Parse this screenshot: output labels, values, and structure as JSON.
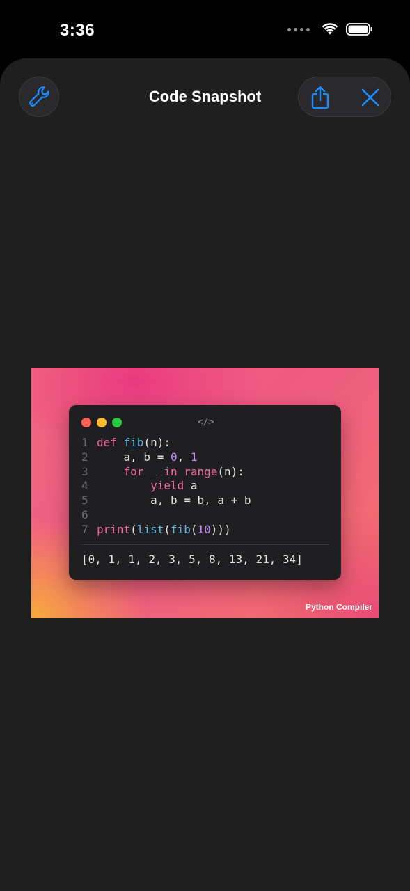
{
  "status_bar": {
    "time": "3:36"
  },
  "header": {
    "title": "Code Snapshot",
    "left_button_icon": "wrench-icon",
    "share_button_icon": "share-icon",
    "close_button_icon": "close-icon"
  },
  "colors": {
    "accent": "#1a8cff",
    "sheet_background": "#1f1f20",
    "code_background": "#1f1f21"
  },
  "snapshot": {
    "window_icon": "code-brackets-icon",
    "window_icon_glyph": "</>",
    "code_lines": [
      {
        "number": "1",
        "tokens": [
          {
            "t": "def ",
            "c": "kw"
          },
          {
            "t": "fib",
            "c": "fn"
          },
          {
            "t": "(n):",
            "c": "plain"
          }
        ]
      },
      {
        "number": "2",
        "tokens": [
          {
            "t": "    a, b = ",
            "c": "plain"
          },
          {
            "t": "0",
            "c": "num"
          },
          {
            "t": ", ",
            "c": "plain"
          },
          {
            "t": "1",
            "c": "num"
          }
        ]
      },
      {
        "number": "3",
        "tokens": [
          {
            "t": "    ",
            "c": "plain"
          },
          {
            "t": "for",
            "c": "kw"
          },
          {
            "t": " _ ",
            "c": "plain"
          },
          {
            "t": "in",
            "c": "kw"
          },
          {
            "t": " ",
            "c": "plain"
          },
          {
            "t": "range",
            "c": "kw"
          },
          {
            "t": "(n):",
            "c": "plain"
          }
        ]
      },
      {
        "number": "4",
        "tokens": [
          {
            "t": "        ",
            "c": "plain"
          },
          {
            "t": "yield",
            "c": "kw"
          },
          {
            "t": " a",
            "c": "plain"
          }
        ]
      },
      {
        "number": "5",
        "tokens": [
          {
            "t": "        a, b = b, a + b",
            "c": "plain"
          }
        ]
      },
      {
        "number": "6",
        "tokens": []
      },
      {
        "number": "7",
        "tokens": [
          {
            "t": "print",
            "c": "kw"
          },
          {
            "t": "(",
            "c": "plain"
          },
          {
            "t": "list",
            "c": "fn"
          },
          {
            "t": "(",
            "c": "plain"
          },
          {
            "t": "fib",
            "c": "fn"
          },
          {
            "t": "(",
            "c": "plain"
          },
          {
            "t": "10",
            "c": "num"
          },
          {
            "t": ")))",
            "c": "plain"
          }
        ]
      }
    ],
    "output": "[0, 1, 1, 2, 3, 5, 8, 13, 21, 34]",
    "watermark": "Python Compiler"
  }
}
